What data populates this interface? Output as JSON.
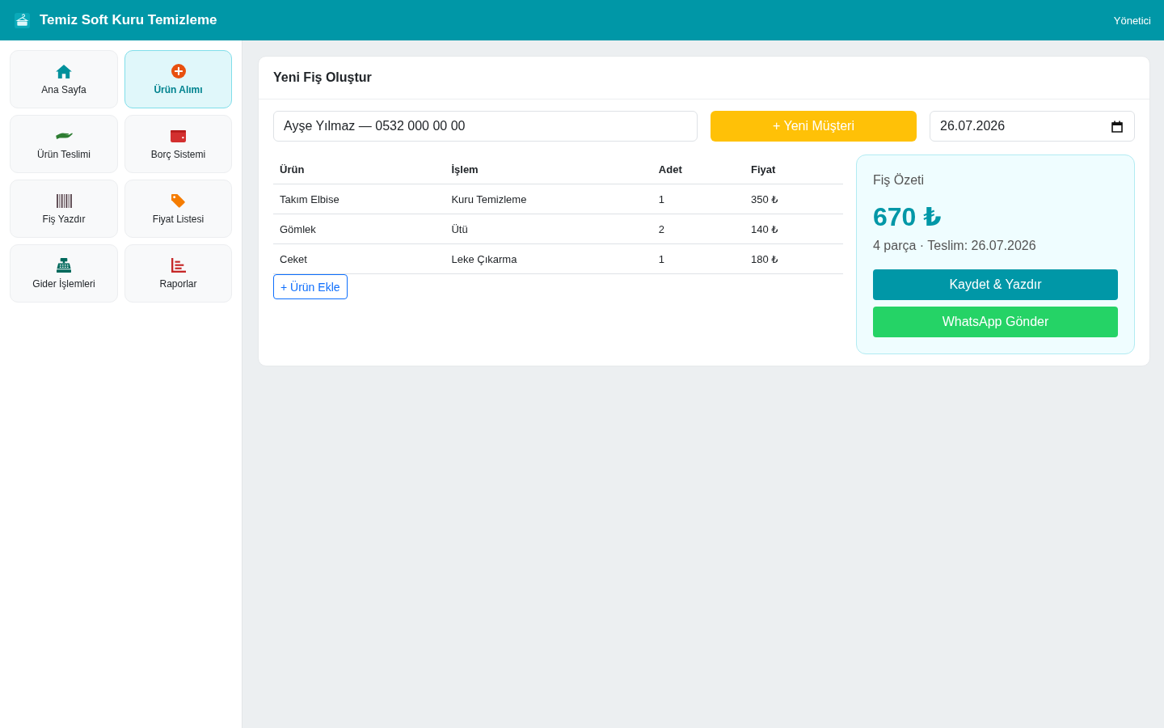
{
  "header": {
    "title": "Temiz Soft Kuru Temizleme",
    "user": "Yönetici"
  },
  "sidebar": {
    "items": [
      {
        "label": "Ana Sayfa",
        "selected": false
      },
      {
        "label": "Ürün Alımı",
        "selected": true
      },
      {
        "label": "Ürün Teslimi",
        "selected": false
      },
      {
        "label": "Borç Sistemi",
        "selected": false
      },
      {
        "label": "Fiş Yazdır",
        "selected": false
      },
      {
        "label": "Fiyat Listesi",
        "selected": false
      },
      {
        "label": "Gider İşlemleri",
        "selected": false
      },
      {
        "label": "Raporlar",
        "selected": false
      }
    ]
  },
  "form": {
    "title": "Yeni Fiş Oluştur",
    "customer_field": {
      "value": "Ayşe Yılmaz — 0532 000 00 00"
    },
    "new_customer_button": "+ Yeni Müşteri",
    "date_field": {
      "value": "26.07.2026"
    },
    "table": {
      "columns": [
        "Ürün",
        "İşlem",
        "Adet",
        "Fiyat"
      ],
      "rows": [
        [
          "Takım Elbise",
          "Kuru Temizleme",
          "1",
          "350 ₺"
        ],
        [
          "Gömlek",
          "Ütü",
          "2",
          "140 ₺"
        ],
        [
          "Ceket",
          "Leke Çıkarma",
          "1",
          "180 ₺"
        ]
      ]
    },
    "add_item_button": "+ Ürün Ekle",
    "summary": {
      "title": "Fiş Özeti",
      "total": "670 ₺",
      "details": "4 parça · Teslim: 26.07.2026",
      "buttons": [
        {
          "label": "Kaydet & Yazdır",
          "kind": "primary"
        },
        {
          "label": "WhatsApp Gönder",
          "kind": "whatsapp"
        }
      ]
    }
  }
}
